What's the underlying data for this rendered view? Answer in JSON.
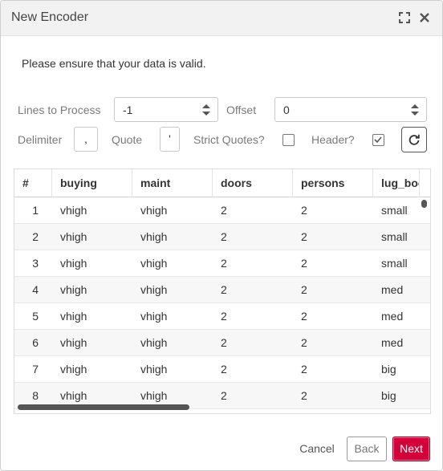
{
  "dialog": {
    "title": "New Encoder"
  },
  "message": "Please ensure that your data is valid.",
  "controls": {
    "lines_label": "Lines to Process",
    "lines_value": "-1",
    "offset_label": "Offset",
    "offset_value": "0",
    "delimiter_label": "Delimiter",
    "delimiter_value": ",",
    "quote_label": "Quote",
    "quote_value": "'",
    "strict_quotes_label": "Strict Quotes?",
    "strict_quotes_checked": false,
    "header_label": "Header?",
    "header_checked": true
  },
  "table": {
    "columns": [
      "#",
      "buying",
      "maint",
      "doors",
      "persons",
      "lug_boot"
    ],
    "rows": [
      [
        "1",
        "vhigh",
        "vhigh",
        "2",
        "2",
        "small"
      ],
      [
        "2",
        "vhigh",
        "vhigh",
        "2",
        "2",
        "small"
      ],
      [
        "3",
        "vhigh",
        "vhigh",
        "2",
        "2",
        "small"
      ],
      [
        "4",
        "vhigh",
        "vhigh",
        "2",
        "2",
        "med"
      ],
      [
        "5",
        "vhigh",
        "vhigh",
        "2",
        "2",
        "med"
      ],
      [
        "6",
        "vhigh",
        "vhigh",
        "2",
        "2",
        "med"
      ],
      [
        "7",
        "vhigh",
        "vhigh",
        "2",
        "2",
        "big"
      ],
      [
        "8",
        "vhigh",
        "vhigh",
        "2",
        "2",
        "big"
      ]
    ]
  },
  "buttons": {
    "cancel": "Cancel",
    "back": "Back",
    "next": "Next"
  },
  "colors": {
    "accent": "#d4003a",
    "titlebar": "#f2f2f2"
  }
}
